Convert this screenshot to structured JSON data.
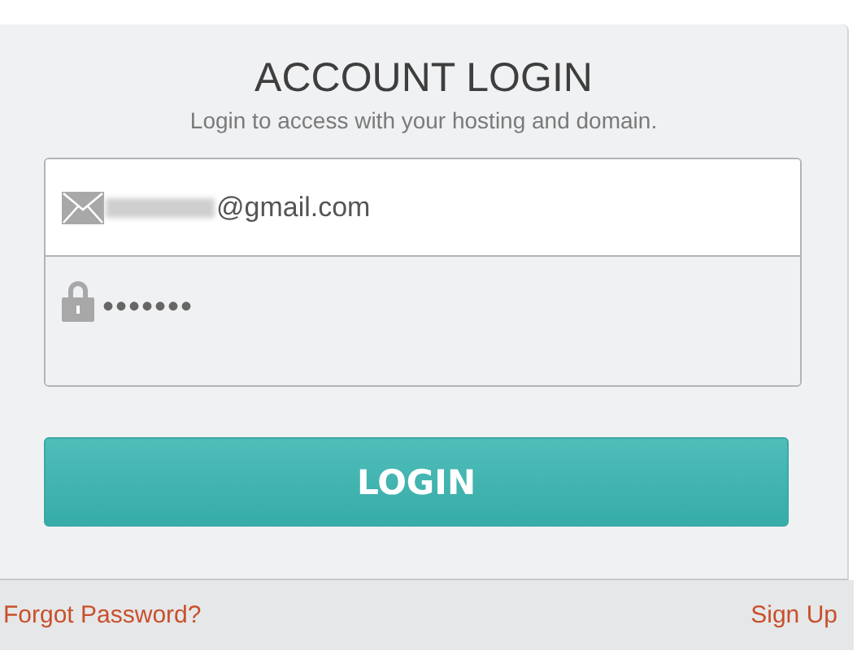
{
  "title": "ACCOUNT LOGIN",
  "subtitle": "Login to access with your hosting and domain.",
  "email_field": {
    "value": "@gmail.com"
  },
  "password_field": {
    "value": "•••••••"
  },
  "login_button": "LOGIN",
  "footer_links": [
    "Forgot Password?",
    "Sign Up"
  ]
}
